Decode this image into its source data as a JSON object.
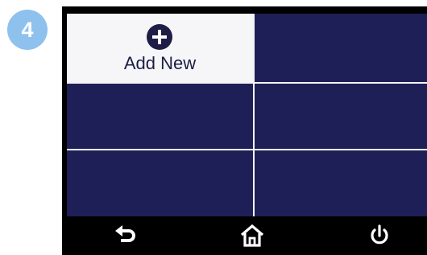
{
  "step_badge": "4",
  "tiles": [
    {
      "label": "Add New",
      "icon": "plus-circle-icon",
      "selected": true
    },
    {
      "label": ""
    },
    {
      "label": ""
    },
    {
      "label": ""
    },
    {
      "label": ""
    },
    {
      "label": ""
    }
  ],
  "nav_bar": {
    "items": [
      {
        "icon": "back-arrow-icon"
      },
      {
        "icon": "home-icon"
      },
      {
        "icon": "power-icon"
      }
    ]
  },
  "colors": {
    "badge": "#8ec1ee",
    "tile_dark": "#1f1f57",
    "tile_selected": "#f6f6f8",
    "grid_lines": "#f5f5f5",
    "nav_bar": "#000000"
  }
}
